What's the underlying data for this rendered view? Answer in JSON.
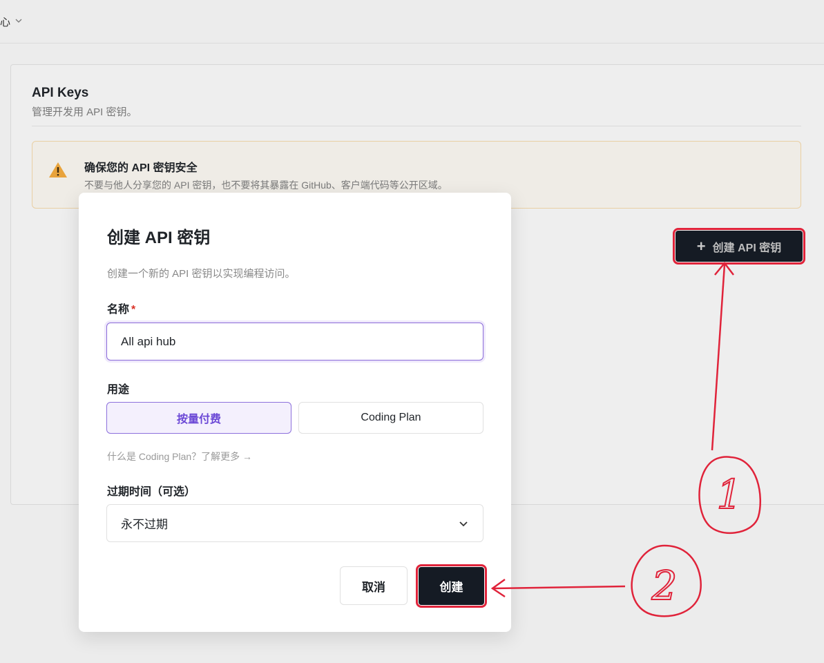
{
  "topbar": {
    "crumb": "心",
    "chevron_icon": "chevron-down-icon"
  },
  "card": {
    "title": "API Keys",
    "subtitle": "管理开发用 API 密钥。",
    "warning": {
      "icon": "warning-triangle-icon",
      "title": "确保您的 API 密钥安全",
      "description": "不要与他人分享您的 API 密钥，也不要将其暴露在 GitHub、客户端代码等公开区域。"
    },
    "create_button": {
      "icon": "plus-icon",
      "label": "创建 API 密钥"
    }
  },
  "modal": {
    "title": "创建 API 密钥",
    "description": "创建一个新的 API 密钥以实现编程访问。",
    "name_label": "名称",
    "required_mark": "*",
    "name_value": "All api hub",
    "usage_label": "用途",
    "usage_options": [
      "按量付费",
      "Coding Plan"
    ],
    "usage_selected": "按量付费",
    "coding_plan_link": "什么是 Coding Plan？了解更多 →",
    "expiry_label": "过期时间（可选）",
    "expiry_value": "永不过期",
    "cancel_label": "取消",
    "create_label": "创建"
  },
  "annotations": {
    "marker_1": "1",
    "marker_2": "2",
    "color": "#e0233a"
  },
  "colors": {
    "primary_dark": "#151b24",
    "accent_purple": "#6b48d6",
    "highlight_red": "#e0233a"
  }
}
